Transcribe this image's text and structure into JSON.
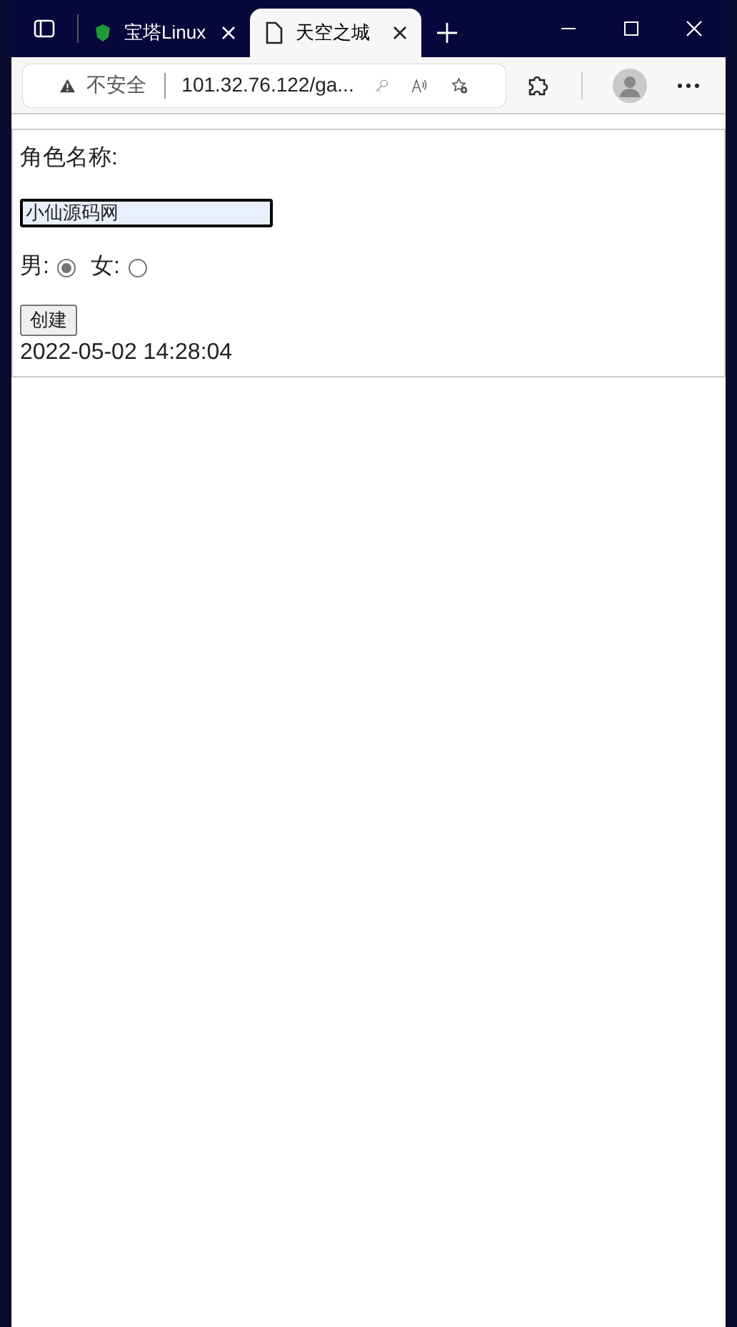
{
  "tabs": [
    {
      "title": "宝塔Linux",
      "selected": false,
      "kind": "site"
    },
    {
      "title": "天空之城",
      "selected": true,
      "kind": "page"
    }
  ],
  "address_bar": {
    "security": "不安全",
    "url": "101.32.76.122/ga..."
  },
  "form": {
    "name_label": "角色名称:",
    "name_value": "小仙源码网",
    "genders": [
      {
        "label": "男:",
        "selected": true
      },
      {
        "label": "女:",
        "selected": false
      }
    ],
    "button": "创建",
    "timestamp": "2022-05-02 14:28:04"
  }
}
